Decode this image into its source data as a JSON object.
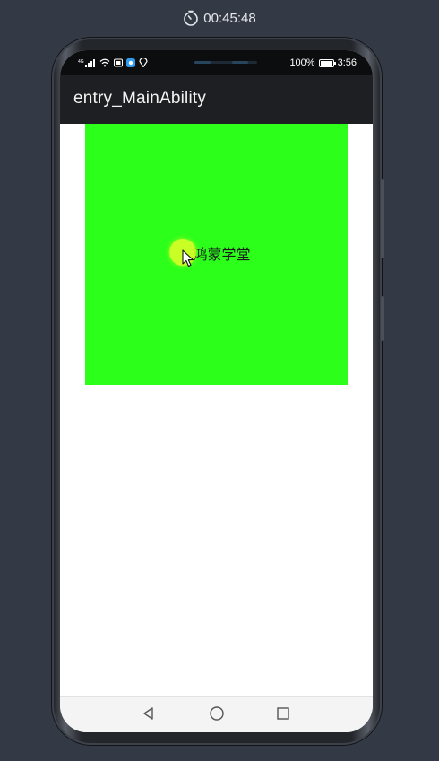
{
  "recording": {
    "timer": "00:45:48",
    "icon": "stopwatch-icon"
  },
  "status_bar": {
    "signal_label": "4G",
    "battery_percent": "100%",
    "time": "3:56",
    "icons": [
      "signal-icon",
      "wifi-icon",
      "nfc-icon",
      "app-badge-icon",
      "location-icon",
      "battery-icon"
    ]
  },
  "app_bar": {
    "title": "entry_MainAbility"
  },
  "main": {
    "box_label": "鸿蒙学堂",
    "box_color": "#2bff1a"
  },
  "nav_bar": {
    "icons": [
      "back-icon",
      "home-icon",
      "recent-apps-icon"
    ]
  }
}
